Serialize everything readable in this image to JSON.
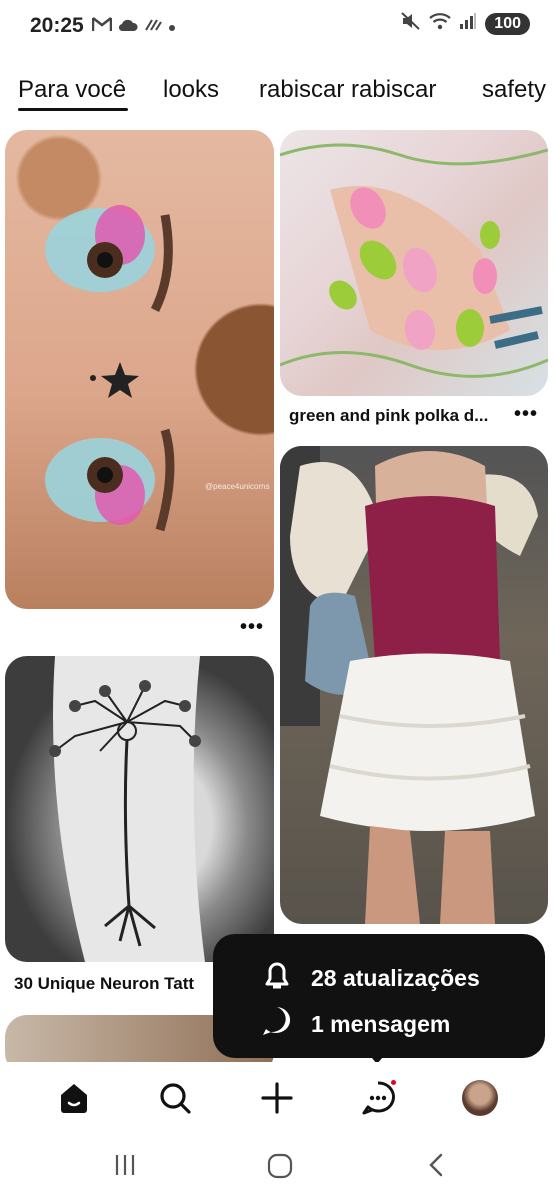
{
  "status_bar": {
    "time": "20:25",
    "battery": "100",
    "left_icons": [
      "gmail-icon",
      "cloud-icon",
      "game-icon",
      "dot-icon"
    ],
    "right_icons": [
      "mute-icon",
      "wifi-icon",
      "signal-icon"
    ]
  },
  "tabs": [
    {
      "label": "Para você",
      "active": true
    },
    {
      "label": "looks",
      "active": false
    },
    {
      "label": "rabiscar rabiscar",
      "active": false
    },
    {
      "label": "safety",
      "active": false
    }
  ],
  "pins": [
    {
      "title": "",
      "image": "makeup-eyes-photo",
      "watermark": "@peace4unicorns"
    },
    {
      "title": "green and pink polka d...",
      "image": "nails-photo"
    },
    {
      "title": "",
      "image": "outfit-photo"
    },
    {
      "title": "30 Unique Neuron Tatt",
      "image": "neuron-tattoo-photo"
    }
  ],
  "popup": {
    "updates": "28 atualizações",
    "messages": "1 mensagem"
  },
  "bottom_nav": [
    "home-icon",
    "search-icon",
    "create-icon",
    "messages-icon",
    "profile-avatar"
  ],
  "colors": {
    "accent": "#e60023",
    "popup_bg": "#111111"
  }
}
